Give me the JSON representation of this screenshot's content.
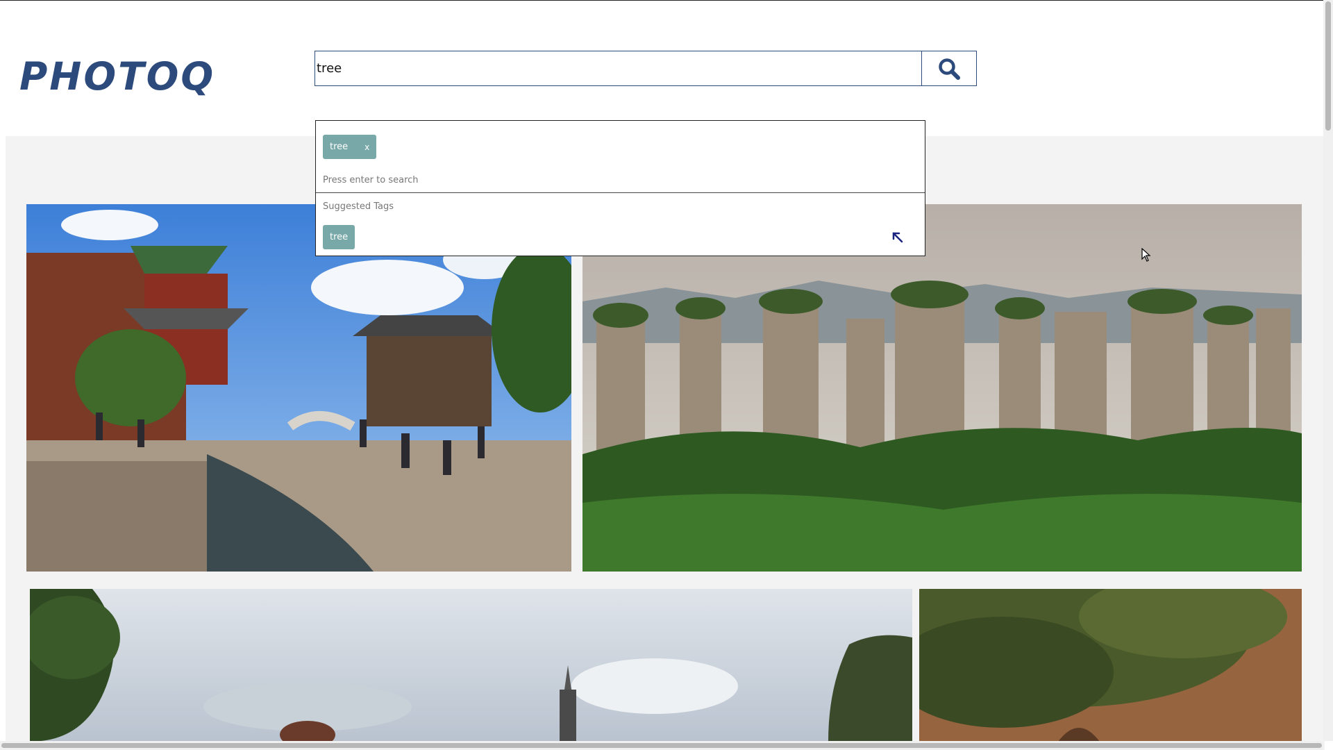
{
  "app": {
    "logo": "PHOTOQ"
  },
  "search": {
    "value": "tree",
    "button_icon": "search-icon"
  },
  "dropdown": {
    "selected_tags": [
      {
        "label": "tree",
        "remove_label": "x"
      }
    ],
    "hint": "Press enter to search",
    "suggested_label": "Suggested Tags",
    "suggested_tags": [
      "tree"
    ],
    "pin_icon": "arrow-up-left-icon"
  },
  "colors": {
    "brand": "#2c4a7c",
    "tag": "#78a8a8",
    "gallery_bg": "#f3f3f3"
  },
  "gallery": {
    "photos": [
      {
        "name": "old-town-canal-photo"
      },
      {
        "name": "karst-pillars-forest-photo"
      },
      {
        "name": "cloudy-sky-tower-photo"
      },
      {
        "name": "pine-tree-cliff-photo"
      }
    ]
  }
}
